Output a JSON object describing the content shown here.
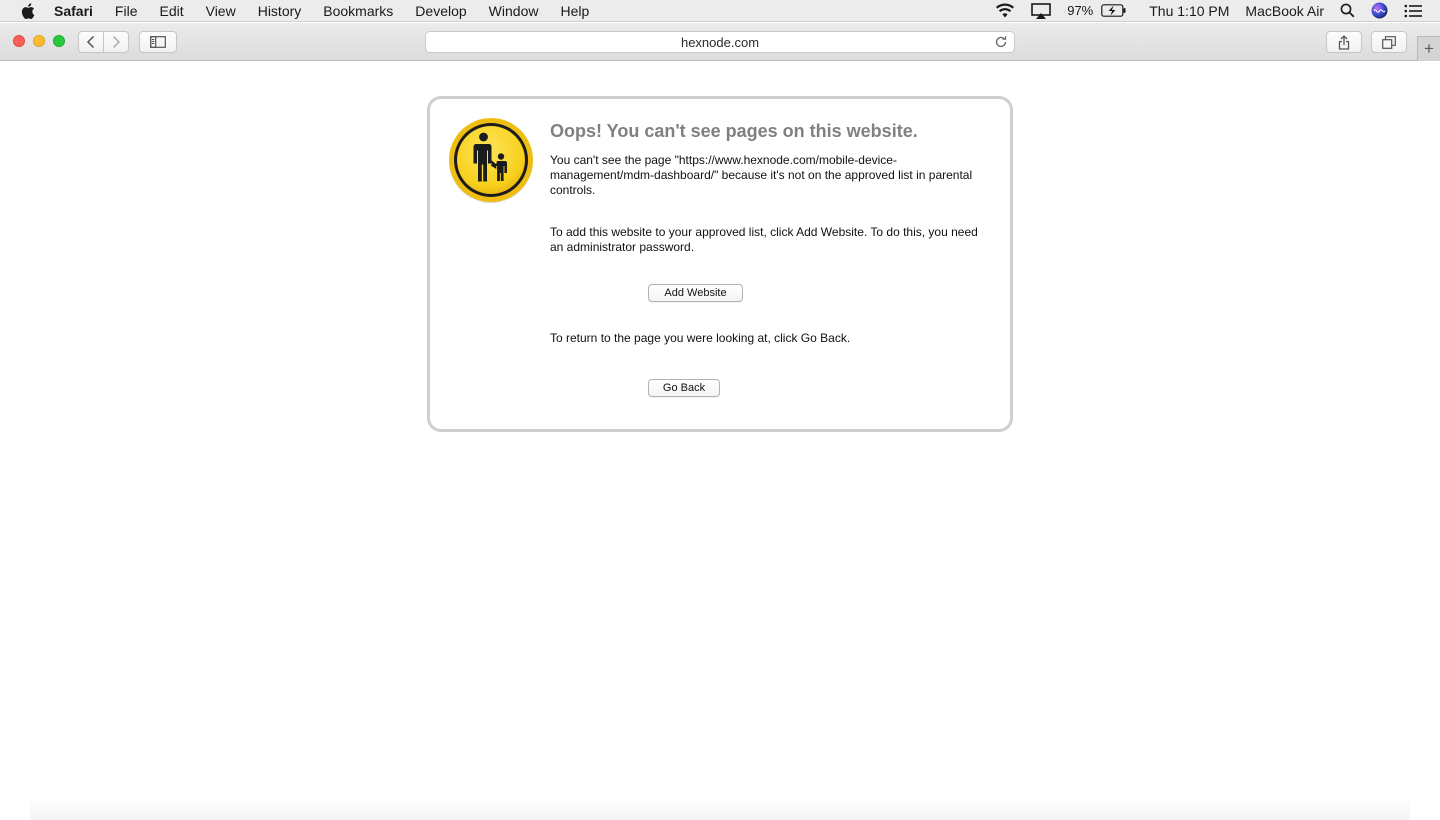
{
  "menubar": {
    "app_name": "Safari",
    "items": [
      "File",
      "Edit",
      "View",
      "History",
      "Bookmarks",
      "Develop",
      "Window",
      "Help"
    ],
    "battery": "97%",
    "clock": "Thu 1:10 PM",
    "computer_name": "MacBook Air"
  },
  "toolbar": {
    "address": "hexnode.com",
    "new_tab": "+"
  },
  "page": {
    "title": "Oops! You can't see pages on this website.",
    "message_1": "You can't see the page \"https://www.hexnode.com/mobile-device-management/mdm-dashboard/\" because it's not on the approved list in parental controls.",
    "message_2": "To add this website to your approved list, click Add Website. To do this, you need an administrator password.",
    "add_website_label": "Add Website",
    "message_3": "To return to the page you were looking at, click Go Back.",
    "go_back_label": "Go Back"
  },
  "colors": {
    "badge_yellow": "#f7d11c",
    "title_gray": "#808080",
    "card_border": "#cfcfcf"
  }
}
